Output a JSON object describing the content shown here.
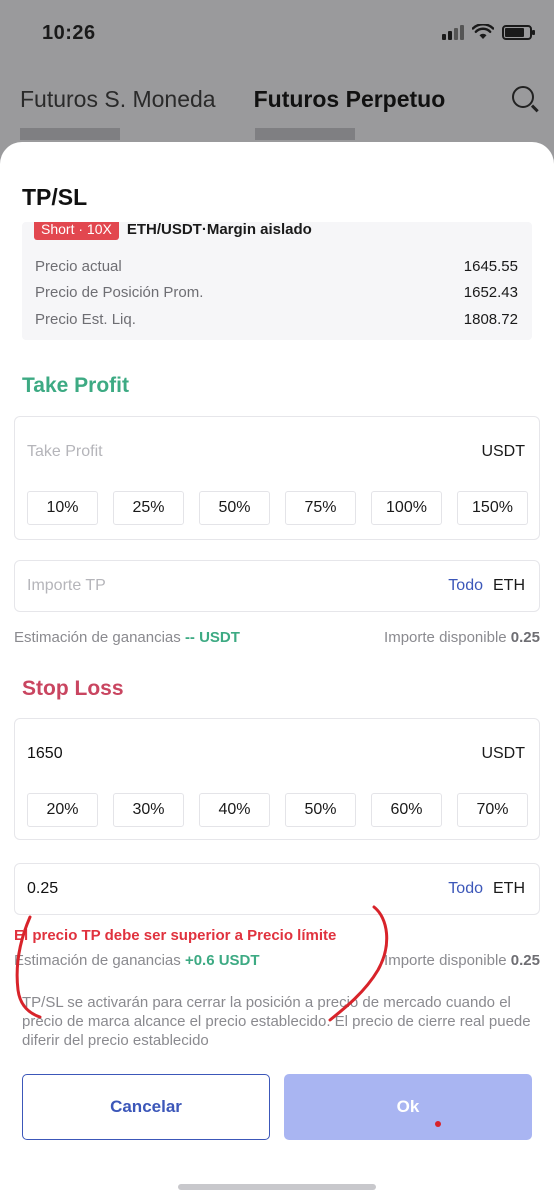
{
  "status_bar": {
    "time": "10:26"
  },
  "background": {
    "tabs": [
      {
        "label": "Futuros S. Moneda",
        "active": false
      },
      {
        "label": "Futuros Perpetuo",
        "active": true
      }
    ]
  },
  "sheet": {
    "title": "TP/SL",
    "position": {
      "side_badge": "Short · 10X",
      "pair": "ETH/USDT·Margin aislado",
      "rows": [
        {
          "label": "Precio actual",
          "value": "1645.55"
        },
        {
          "label": "Precio de Posición Prom.",
          "value": "1652.43"
        },
        {
          "label": "Precio Est. Liq.",
          "value": "1808.72"
        }
      ]
    },
    "take_profit": {
      "title": "Take Profit",
      "price_placeholder": "Take Profit",
      "unit": "USDT",
      "percentages": [
        "10%",
        "25%",
        "50%",
        "75%",
        "100%",
        "150%"
      ],
      "amount_placeholder": "Importe TP",
      "all_label": "Todo",
      "amount_unit": "ETH",
      "est_label": "Estimación de ganancias",
      "est_value": "-- USDT",
      "avail_label": "Importe disponible",
      "avail_value": "0.25"
    },
    "stop_loss": {
      "title": "Stop Loss",
      "price_value": "1650",
      "unit": "USDT",
      "percentages": [
        "20%",
        "30%",
        "40%",
        "50%",
        "60%",
        "70%"
      ],
      "amount_value": "0.25",
      "all_label": "Todo",
      "amount_unit": "ETH",
      "error": "El precio TP debe ser superior a Precio límite",
      "est_label": "Estimación de ganancias",
      "est_value": "+0.6 USDT",
      "avail_label": "Importe disponible",
      "avail_value": "0.25"
    },
    "note": "TP/SL se activarán para cerrar la posición a precio de mercado cuando el precio de marca alcance el precio establecido. El precio de cierre real puede diferir del precio establecido",
    "buttons": {
      "cancel": "Cancelar",
      "ok": "Ok"
    },
    "colors": {
      "tp": "#3daa83",
      "sl": "#c94560",
      "primary": "#3c57b9",
      "ok_disabled": "#a9b5f2",
      "error": "#e0323e"
    }
  }
}
